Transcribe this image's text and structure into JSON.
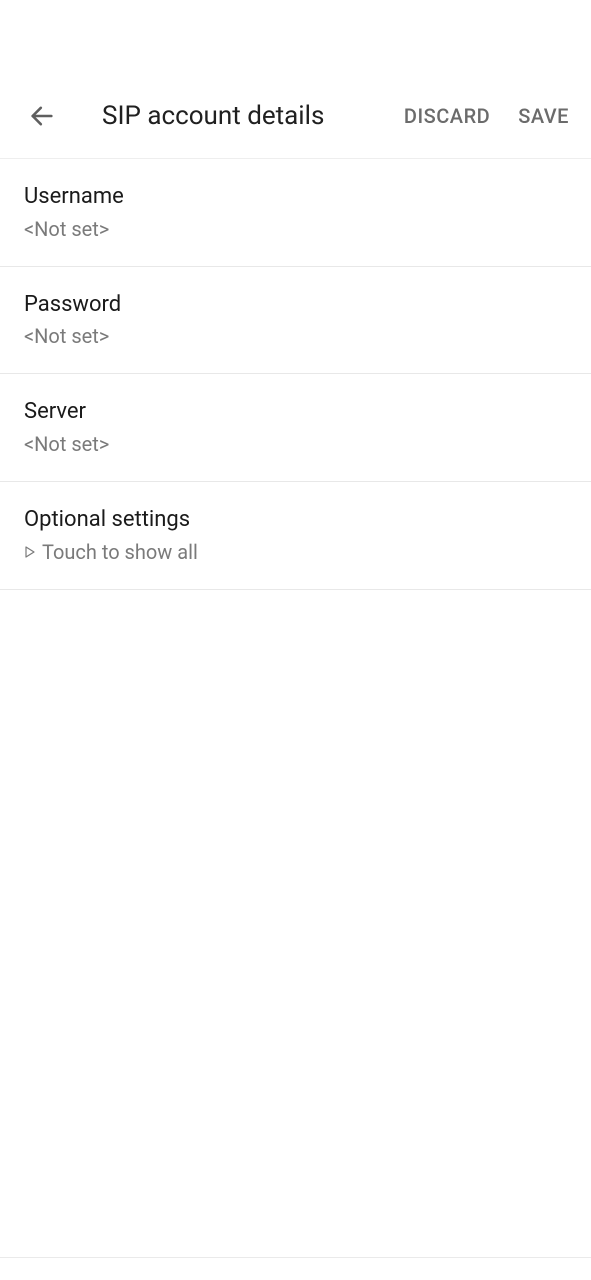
{
  "header": {
    "title": "SIP account details",
    "discard_label": "DISCARD",
    "save_label": "SAVE"
  },
  "settings": {
    "username": {
      "label": "Username",
      "value": "<Not set>"
    },
    "password": {
      "label": "Password",
      "value": "<Not set>"
    },
    "server": {
      "label": "Server",
      "value": "<Not set>"
    },
    "optional": {
      "label": "Optional settings",
      "hint": "Touch to show all"
    }
  }
}
